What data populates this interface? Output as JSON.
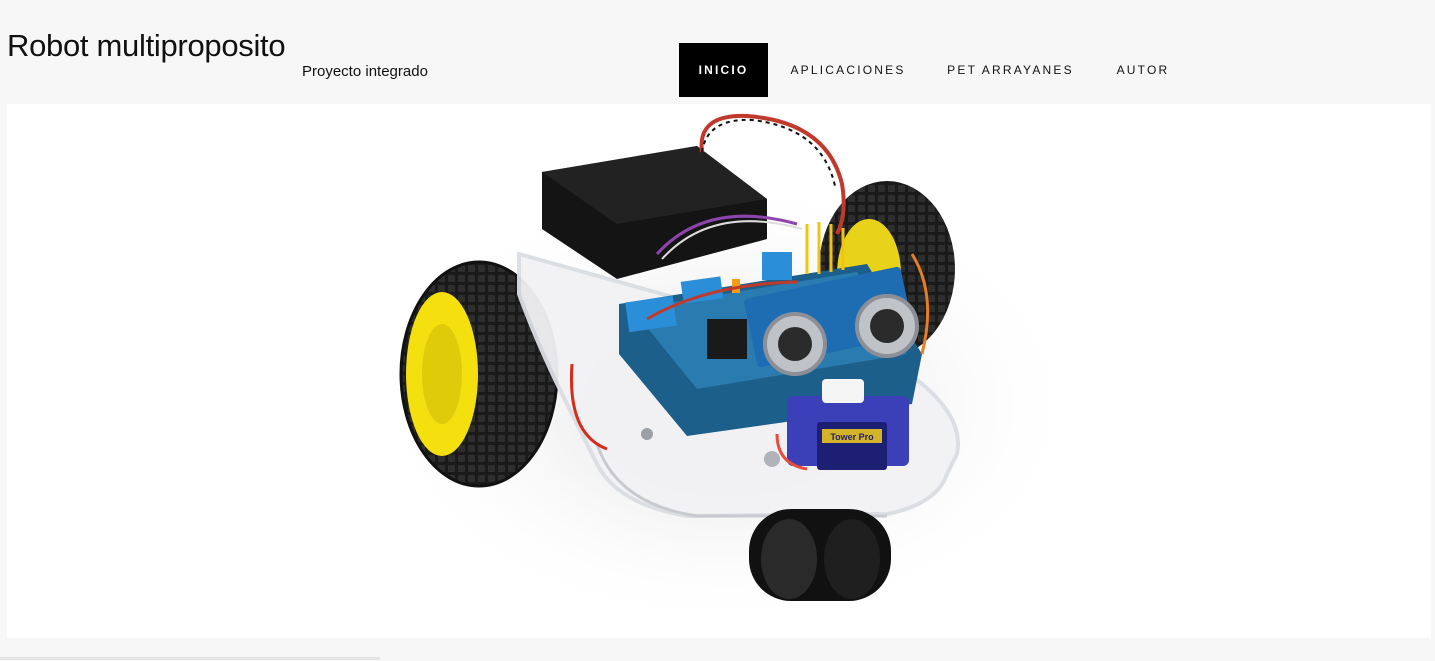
{
  "site": {
    "title": "Robot multiproposito",
    "subtitle": "Proyecto integrado"
  },
  "nav": {
    "items": [
      {
        "label": "INICIO",
        "active": true
      },
      {
        "label": "APLICACIONES",
        "active": false
      },
      {
        "label": "PET ARRAYANES",
        "active": false
      },
      {
        "label": "AUTOR",
        "active": false
      }
    ]
  },
  "hero": {
    "image_subject": "robot-car-photo",
    "servo_label": "Tower Pro"
  },
  "colors": {
    "page_bg": "#f7f7f7",
    "nav_active_bg": "#000000",
    "nav_active_text": "#ffffff",
    "hero_bg": "#ffffff"
  }
}
